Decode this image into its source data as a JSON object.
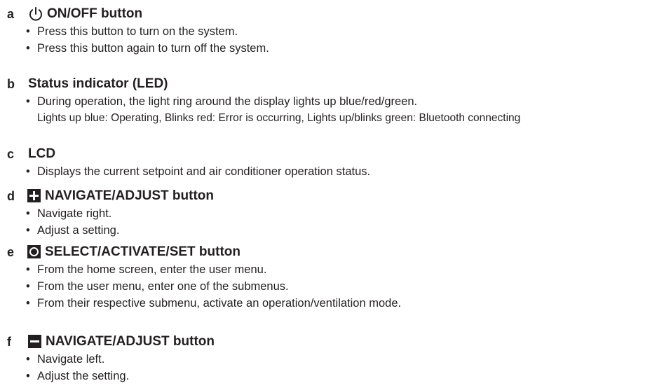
{
  "sections": [
    {
      "letter": "a",
      "icon": "power-icon",
      "title": "ON/OFF button",
      "items": [
        "Press this button to turn on the system.",
        "Press this button again to turn off the system."
      ]
    },
    {
      "letter": "b",
      "title": "Status indicator (LED)",
      "items": [
        "During operation, the light ring around the display lights up blue/red/green."
      ],
      "note": "Lights up blue: Operating, Blinks red: Error is occurring, Lights up/blinks green: Bluetooth connecting"
    },
    {
      "letter": "c",
      "title": "LCD",
      "items": [
        "Displays the current setpoint and air conditioner operation status."
      ]
    },
    {
      "letter": "d",
      "icon": "plus-icon",
      "title": "NAVIGATE/ADJUST button",
      "items": [
        "Navigate right.",
        "Adjust a setting."
      ]
    },
    {
      "letter": "e",
      "icon": "circle-icon",
      "title": "SELECT/ACTIVATE/SET button",
      "items": [
        "From the home screen, enter the user menu.",
        "From the user menu, enter one of the submenus.",
        "From their respective submenu, activate an operation/ventilation mode."
      ]
    },
    {
      "letter": "f",
      "icon": "minus-icon",
      "title": "NAVIGATE/ADJUST button",
      "items": [
        "Navigate left.",
        "Adjust the setting."
      ]
    }
  ],
  "bullet_glyph": "•"
}
